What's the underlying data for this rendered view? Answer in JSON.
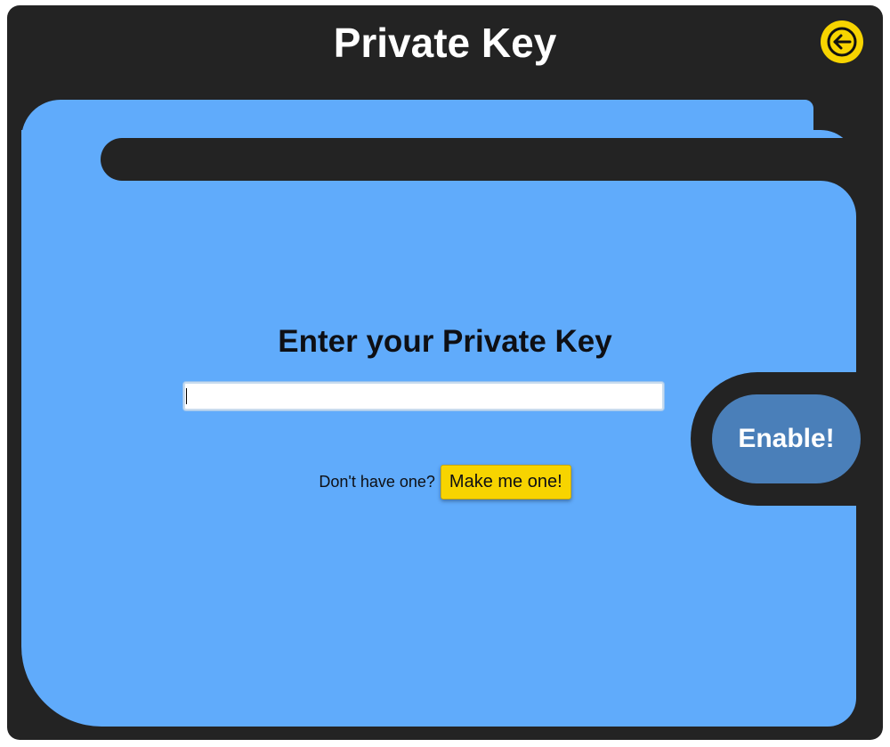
{
  "header": {
    "title": "Private Key",
    "back_icon": "arrow-left-circle-icon"
  },
  "form": {
    "heading": "Enter your Private Key",
    "input_value": "",
    "input_placeholder": ""
  },
  "actions": {
    "enable_label": "Enable!",
    "prompt": "Don't have one?",
    "make_label": "Make me one!"
  },
  "colors": {
    "frame": "#232323",
    "panel": "#60abfb",
    "accent_yellow": "#f7d400",
    "enable_button": "#4a7fb9"
  }
}
